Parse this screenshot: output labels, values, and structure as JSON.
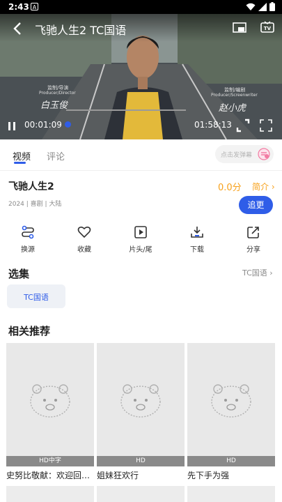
{
  "status_bar": {
    "time": "2:43",
    "app_badge": "A"
  },
  "player": {
    "title": "飞驰人生2  TC国语",
    "current_time": "00:01:09",
    "total_time": "01:58:13",
    "progress_fraction": 0.01,
    "caption_left_top": "监制/导演",
    "caption_left_sub": "Producer/Director",
    "signature_left": "白玉俊",
    "caption_right_top": "监制/编剧",
    "caption_right_sub": "Producer/Screenwriter",
    "signature_right": "赵小虎"
  },
  "tabs": [
    {
      "label": "视频",
      "active": true
    },
    {
      "label": "评论",
      "active": false
    }
  ],
  "danmu": {
    "placeholder": "点击发弹幕",
    "icon": "danmu-icon"
  },
  "info": {
    "title": "飞驰人生2",
    "meta": "2024 | 喜剧 | 大陆",
    "score": "0.0分",
    "intro": "简介",
    "follow": "追更"
  },
  "actions": [
    {
      "label": "换源",
      "icon": "switch-source-icon"
    },
    {
      "label": "收藏",
      "icon": "heart-icon"
    },
    {
      "label": "片头/尾",
      "icon": "play-box-icon"
    },
    {
      "label": "下载",
      "icon": "download-icon"
    },
    {
      "label": "分享",
      "icon": "share-icon"
    }
  ],
  "episodes": {
    "title": "选集",
    "source": "TC国语",
    "items": [
      "TC国语"
    ]
  },
  "recommend": {
    "title": "相关推荐",
    "items": [
      {
        "badge": "HD中字",
        "title": "史努比敬献：欢迎回…"
      },
      {
        "badge": "HD",
        "title": "姐妹狂欢行"
      },
      {
        "badge": "HD",
        "title": "先下手为强"
      }
    ]
  },
  "colors": {
    "accent": "#2f5de8",
    "score": "#f7a11b"
  }
}
